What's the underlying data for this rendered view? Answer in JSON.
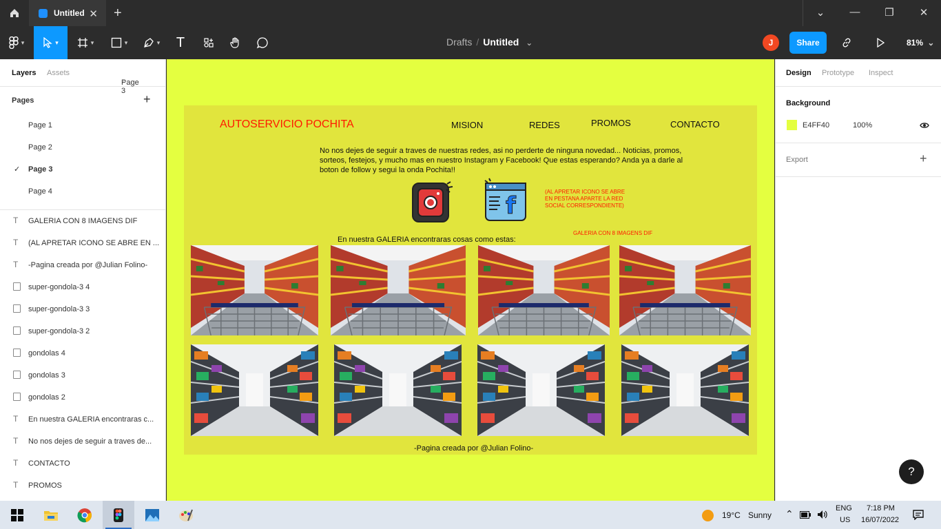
{
  "titlebar": {
    "tab_title": "Untitled",
    "close_glyph": "✕",
    "new_tab_glyph": "+",
    "min_glyph": "—",
    "max_glyph": "❐",
    "close_win_glyph": "✕",
    "chevron_glyph": "⌄"
  },
  "toolbar": {
    "breadcrumb_drafts": "Drafts",
    "breadcrumb_sep": "/",
    "file_title": "Untitled",
    "title_caret": "⌄",
    "avatar_initial": "J",
    "share_label": "Share",
    "zoom_label": "81%",
    "zoom_caret": "⌄",
    "text_tool_glyph": "T"
  },
  "left_panel": {
    "tabs": {
      "layers": "Layers",
      "assets": "Assets",
      "current_page": "Page 3",
      "page_caret": "⌃"
    },
    "pages_label": "Pages",
    "add_page_glyph": "+",
    "pages": [
      {
        "label": "Page 1",
        "current": false
      },
      {
        "label": "Page 2",
        "current": false
      },
      {
        "label": "Page 3",
        "current": true
      },
      {
        "label": "Page 4",
        "current": false
      }
    ],
    "current_mark": "✓",
    "layers": [
      {
        "type": "text",
        "glyph": "T",
        "label": "GALERIA CON 8 IMAGENS DIF"
      },
      {
        "type": "text",
        "glyph": "T",
        "label": "(AL APRETAR ICONO SE ABRE EN ..."
      },
      {
        "type": "text",
        "glyph": "T",
        "label": "-Pagina creada por @Julian Folino-"
      },
      {
        "type": "image",
        "glyph": "",
        "label": "super-gondola-3 4"
      },
      {
        "type": "image",
        "glyph": "",
        "label": "super-gondola-3 3"
      },
      {
        "type": "image",
        "glyph": "",
        "label": "super-gondola-3 2"
      },
      {
        "type": "image",
        "glyph": "",
        "label": "gondolas 4"
      },
      {
        "type": "image",
        "glyph": "",
        "label": "gondolas 3"
      },
      {
        "type": "image",
        "glyph": "",
        "label": "gondolas 2"
      },
      {
        "type": "text",
        "glyph": "T",
        "label": "En nuestra GALERIA encontraras c..."
      },
      {
        "type": "text",
        "glyph": "T",
        "label": "No nos dejes de seguir a traves de..."
      },
      {
        "type": "text",
        "glyph": "T",
        "label": "CONTACTO"
      },
      {
        "type": "text",
        "glyph": "T",
        "label": "PROMOS"
      }
    ]
  },
  "frame": {
    "brand": "AUTOSERVICIO POCHITA",
    "nav": [
      "MISION",
      "REDES",
      "PROMOS",
      "CONTACTO"
    ],
    "intro": "No nos dejes de seguir a traves de nuestras redes, asi no perderte de ninguna novedad... Noticias, promos, sorteos, festejos, y mucho mas en nuestro Instagram y Facebook! Que estas esperando? Anda ya a darle al boton de follow y segui la onda Pochita!!",
    "icon_note": "(AL APRETAR ICONO SE ABRE EN PESTANA APARTE LA RED SOCIAL CORRESPONDIENTE)",
    "gallery_note": "GALERIA CON 8 IMAGENS DIF",
    "gallery_intro": "En nuestra GALERIA encontraras cosas como estas:",
    "footer": "-Pagina creada por @Julian Folino-",
    "facebook_letter": "f"
  },
  "right_panel": {
    "tabs": {
      "design": "Design",
      "prototype": "Prototype",
      "inspect": "Inspect"
    },
    "background_label": "Background",
    "bg_hex": "E4FF40",
    "bg_opacity": "100%",
    "export_label": "Export",
    "export_add_glyph": "+"
  },
  "help_glyph": "?",
  "taskbar": {
    "weather_temp": "19°C",
    "weather_text": "Sunny",
    "tray_up_glyph": "⌃",
    "volume_glyph": "🔊",
    "lang": "ENG",
    "region": "US",
    "time": "7:18 PM",
    "date": "16/07/2022"
  },
  "colors": {
    "canvas_bg": "#e4ff40",
    "frame_bg": "#e1e53d",
    "accent": "#0d99ff",
    "brand_red": "#ff1a00"
  }
}
